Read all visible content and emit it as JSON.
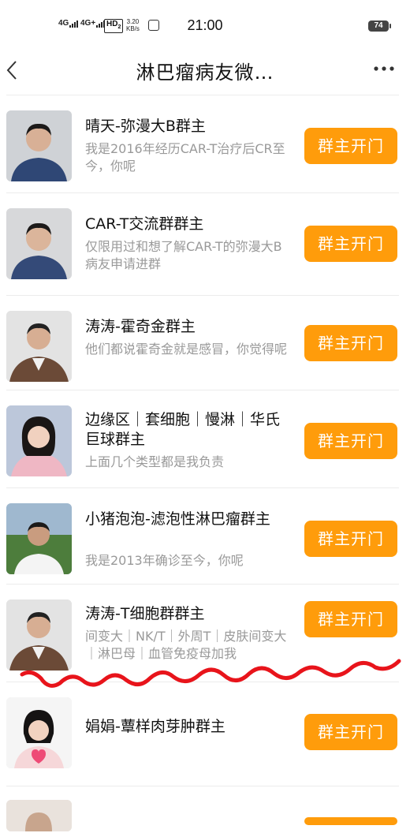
{
  "status_bar": {
    "signal1": "4G",
    "signal2": "4G+",
    "hd": "HD",
    "hd_sub": "2",
    "speed": "3.20",
    "speed_unit": "KB/s",
    "time": "21:00",
    "battery": "74"
  },
  "nav": {
    "title": "淋巴瘤病友微…",
    "back_icon": "chevron-left-icon",
    "more_icon": "more-dots-icon"
  },
  "button_label": "群主开门",
  "colors": {
    "button": "#ff9c0b",
    "desc": "#999999",
    "scribble": "#e8141b"
  },
  "items": [
    {
      "name": "晴天-弥漫大B群主",
      "desc": "我是2016年经历CAR-T治疗后CR至今，你呢"
    },
    {
      "name": "CAR-T交流群群主",
      "desc": "仅限用过和想了解CAR-T的弥漫大B病友申请进群"
    },
    {
      "name": "涛涛-霍奇金群主",
      "desc": "他们都说霍奇金就是感冒，你觉得呢"
    },
    {
      "name": "边缘区｜套细胞｜慢淋｜华氏巨球群主",
      "desc": "上面几个类型都是我负责"
    },
    {
      "name": "小猪泡泡-滤泡性淋巴瘤群主",
      "desc": "我是2013年确诊至今，你呢"
    },
    {
      "name": "涛涛-T细胞群群主",
      "desc": "间变大｜NK/T｜外周T｜皮肤间变大｜淋巴母｜血管免疫母加我"
    },
    {
      "name": "娟娟-蕈样肉芽肿群主",
      "desc": ""
    }
  ]
}
